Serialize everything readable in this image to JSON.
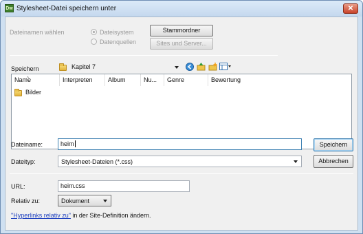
{
  "window": {
    "title": "Stylesheet-Datei speichern unter",
    "app_icon_text": "Dw",
    "close_glyph": "✕"
  },
  "source": {
    "label": "Dateinamen wählen",
    "option_filesystem": "Dateisystem",
    "option_datasources": "Datenquellen",
    "root_button": "Stammordner",
    "sites_button": "Sites und Server..."
  },
  "location": {
    "label": "Speichern",
    "folder": "Kapitel 7"
  },
  "toolbar_icons": [
    "back-icon",
    "up-folder-icon",
    "new-folder-icon",
    "view-menu-icon"
  ],
  "columns": [
    "Name",
    "Interpreten",
    "Album",
    "Nu...",
    "Genre",
    "Bewertung"
  ],
  "files": [
    {
      "name": "Bilder",
      "icon": "folder-icon"
    }
  ],
  "filename": {
    "label": "Dateiname:",
    "value": "heim",
    "save_button": "Speichern"
  },
  "filetype": {
    "label": "Dateityp:",
    "value": "Stylesheet-Dateien (*.css)",
    "cancel_button": "Abbrechen"
  },
  "url": {
    "label": "URL:",
    "value": "heim.css"
  },
  "relative": {
    "label": "Relativ zu:",
    "value": "Dokument"
  },
  "footer": {
    "link": "\"Hyperlinks relativ zu\"",
    "text": " in der Site-Definition ändern."
  },
  "colors": {
    "accent": "#3c7fb1",
    "link": "#1c3fbf",
    "close": "#c8432a"
  }
}
